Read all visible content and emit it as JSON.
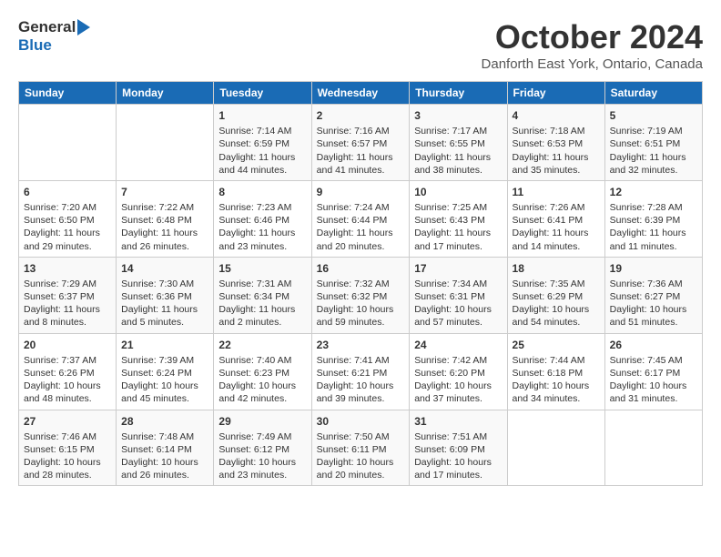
{
  "header": {
    "logo_general": "General",
    "logo_blue": "Blue",
    "month": "October 2024",
    "location": "Danforth East York, Ontario, Canada"
  },
  "days_of_week": [
    "Sunday",
    "Monday",
    "Tuesday",
    "Wednesday",
    "Thursday",
    "Friday",
    "Saturday"
  ],
  "weeks": [
    [
      {
        "day": "",
        "sunrise": "",
        "sunset": "",
        "daylight": ""
      },
      {
        "day": "",
        "sunrise": "",
        "sunset": "",
        "daylight": ""
      },
      {
        "day": "1",
        "sunrise": "Sunrise: 7:14 AM",
        "sunset": "Sunset: 6:59 PM",
        "daylight": "Daylight: 11 hours and 44 minutes."
      },
      {
        "day": "2",
        "sunrise": "Sunrise: 7:16 AM",
        "sunset": "Sunset: 6:57 PM",
        "daylight": "Daylight: 11 hours and 41 minutes."
      },
      {
        "day": "3",
        "sunrise": "Sunrise: 7:17 AM",
        "sunset": "Sunset: 6:55 PM",
        "daylight": "Daylight: 11 hours and 38 minutes."
      },
      {
        "day": "4",
        "sunrise": "Sunrise: 7:18 AM",
        "sunset": "Sunset: 6:53 PM",
        "daylight": "Daylight: 11 hours and 35 minutes."
      },
      {
        "day": "5",
        "sunrise": "Sunrise: 7:19 AM",
        "sunset": "Sunset: 6:51 PM",
        "daylight": "Daylight: 11 hours and 32 minutes."
      }
    ],
    [
      {
        "day": "6",
        "sunrise": "Sunrise: 7:20 AM",
        "sunset": "Sunset: 6:50 PM",
        "daylight": "Daylight: 11 hours and 29 minutes."
      },
      {
        "day": "7",
        "sunrise": "Sunrise: 7:22 AM",
        "sunset": "Sunset: 6:48 PM",
        "daylight": "Daylight: 11 hours and 26 minutes."
      },
      {
        "day": "8",
        "sunrise": "Sunrise: 7:23 AM",
        "sunset": "Sunset: 6:46 PM",
        "daylight": "Daylight: 11 hours and 23 minutes."
      },
      {
        "day": "9",
        "sunrise": "Sunrise: 7:24 AM",
        "sunset": "Sunset: 6:44 PM",
        "daylight": "Daylight: 11 hours and 20 minutes."
      },
      {
        "day": "10",
        "sunrise": "Sunrise: 7:25 AM",
        "sunset": "Sunset: 6:43 PM",
        "daylight": "Daylight: 11 hours and 17 minutes."
      },
      {
        "day": "11",
        "sunrise": "Sunrise: 7:26 AM",
        "sunset": "Sunset: 6:41 PM",
        "daylight": "Daylight: 11 hours and 14 minutes."
      },
      {
        "day": "12",
        "sunrise": "Sunrise: 7:28 AM",
        "sunset": "Sunset: 6:39 PM",
        "daylight": "Daylight: 11 hours and 11 minutes."
      }
    ],
    [
      {
        "day": "13",
        "sunrise": "Sunrise: 7:29 AM",
        "sunset": "Sunset: 6:37 PM",
        "daylight": "Daylight: 11 hours and 8 minutes."
      },
      {
        "day": "14",
        "sunrise": "Sunrise: 7:30 AM",
        "sunset": "Sunset: 6:36 PM",
        "daylight": "Daylight: 11 hours and 5 minutes."
      },
      {
        "day": "15",
        "sunrise": "Sunrise: 7:31 AM",
        "sunset": "Sunset: 6:34 PM",
        "daylight": "Daylight: 11 hours and 2 minutes."
      },
      {
        "day": "16",
        "sunrise": "Sunrise: 7:32 AM",
        "sunset": "Sunset: 6:32 PM",
        "daylight": "Daylight: 10 hours and 59 minutes."
      },
      {
        "day": "17",
        "sunrise": "Sunrise: 7:34 AM",
        "sunset": "Sunset: 6:31 PM",
        "daylight": "Daylight: 10 hours and 57 minutes."
      },
      {
        "day": "18",
        "sunrise": "Sunrise: 7:35 AM",
        "sunset": "Sunset: 6:29 PM",
        "daylight": "Daylight: 10 hours and 54 minutes."
      },
      {
        "day": "19",
        "sunrise": "Sunrise: 7:36 AM",
        "sunset": "Sunset: 6:27 PM",
        "daylight": "Daylight: 10 hours and 51 minutes."
      }
    ],
    [
      {
        "day": "20",
        "sunrise": "Sunrise: 7:37 AM",
        "sunset": "Sunset: 6:26 PM",
        "daylight": "Daylight: 10 hours and 48 minutes."
      },
      {
        "day": "21",
        "sunrise": "Sunrise: 7:39 AM",
        "sunset": "Sunset: 6:24 PM",
        "daylight": "Daylight: 10 hours and 45 minutes."
      },
      {
        "day": "22",
        "sunrise": "Sunrise: 7:40 AM",
        "sunset": "Sunset: 6:23 PM",
        "daylight": "Daylight: 10 hours and 42 minutes."
      },
      {
        "day": "23",
        "sunrise": "Sunrise: 7:41 AM",
        "sunset": "Sunset: 6:21 PM",
        "daylight": "Daylight: 10 hours and 39 minutes."
      },
      {
        "day": "24",
        "sunrise": "Sunrise: 7:42 AM",
        "sunset": "Sunset: 6:20 PM",
        "daylight": "Daylight: 10 hours and 37 minutes."
      },
      {
        "day": "25",
        "sunrise": "Sunrise: 7:44 AM",
        "sunset": "Sunset: 6:18 PM",
        "daylight": "Daylight: 10 hours and 34 minutes."
      },
      {
        "day": "26",
        "sunrise": "Sunrise: 7:45 AM",
        "sunset": "Sunset: 6:17 PM",
        "daylight": "Daylight: 10 hours and 31 minutes."
      }
    ],
    [
      {
        "day": "27",
        "sunrise": "Sunrise: 7:46 AM",
        "sunset": "Sunset: 6:15 PM",
        "daylight": "Daylight: 10 hours and 28 minutes."
      },
      {
        "day": "28",
        "sunrise": "Sunrise: 7:48 AM",
        "sunset": "Sunset: 6:14 PM",
        "daylight": "Daylight: 10 hours and 26 minutes."
      },
      {
        "day": "29",
        "sunrise": "Sunrise: 7:49 AM",
        "sunset": "Sunset: 6:12 PM",
        "daylight": "Daylight: 10 hours and 23 minutes."
      },
      {
        "day": "30",
        "sunrise": "Sunrise: 7:50 AM",
        "sunset": "Sunset: 6:11 PM",
        "daylight": "Daylight: 10 hours and 20 minutes."
      },
      {
        "day": "31",
        "sunrise": "Sunrise: 7:51 AM",
        "sunset": "Sunset: 6:09 PM",
        "daylight": "Daylight: 10 hours and 17 minutes."
      },
      {
        "day": "",
        "sunrise": "",
        "sunset": "",
        "daylight": ""
      },
      {
        "day": "",
        "sunrise": "",
        "sunset": "",
        "daylight": ""
      }
    ]
  ]
}
